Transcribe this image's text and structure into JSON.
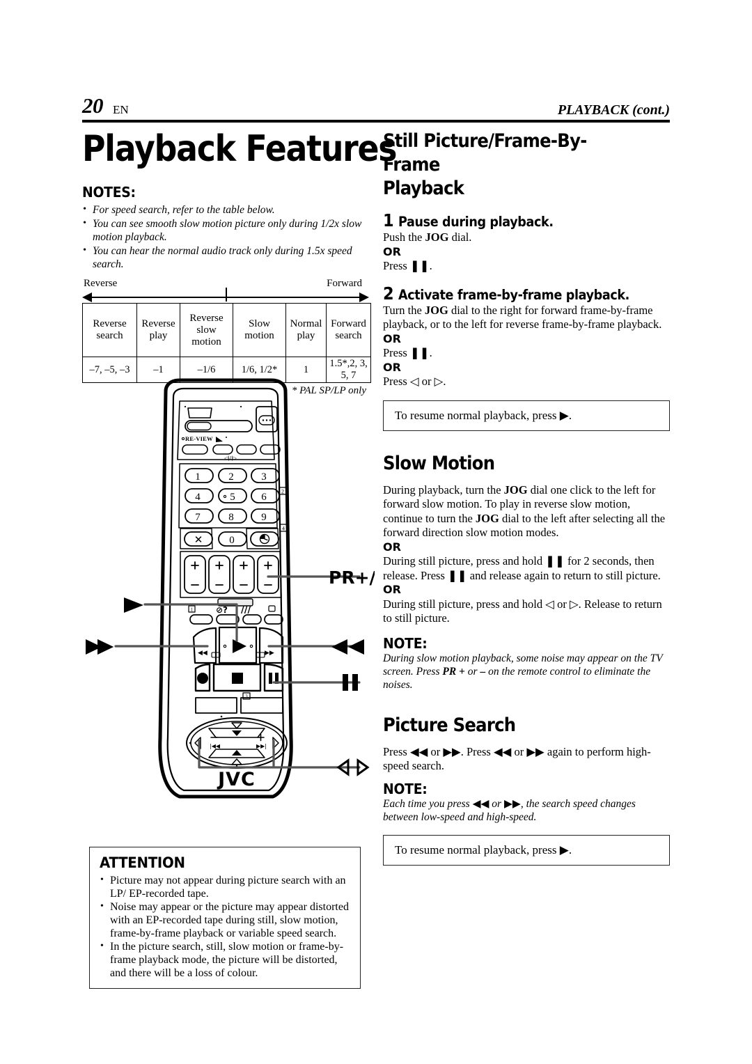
{
  "header": {
    "page_number": "20",
    "language": "EN",
    "running_head": "PLAYBACK (cont.)"
  },
  "left_column": {
    "title": "Playback Features",
    "notes_label": "NOTES:",
    "notes": [
      "For speed search, refer to the table below.",
      "You can see smooth slow motion picture only during 1/2x slow motion playback.",
      "You can hear the normal audio track only during 1.5x speed search."
    ],
    "table": {
      "direction_left": "Reverse",
      "direction_right": "Forward",
      "headers": [
        "Reverse search",
        "Reverse play",
        "Reverse slow motion",
        "Slow motion",
        "Normal play",
        "Forward search"
      ],
      "values": [
        "–7, –5, –3",
        "–1",
        "–1/6",
        "1/6, 1/2*",
        "1",
        "1.5*,2, 3, 5, 7"
      ],
      "footnote": "* PAL SP/LP only"
    }
  },
  "remote": {
    "brand": "JVC",
    "keypad": [
      "1",
      "2",
      "3",
      "4",
      "5",
      "6",
      "7",
      "8",
      "9",
      "X",
      "0",
      "⌚"
    ],
    "review_label": "RE-VIEW",
    "index_markers": [
      "1",
      "2",
      "3",
      "4"
    ],
    "callouts": {
      "pr": "PR+/−",
      "play": "play-arrow",
      "rew": "rewind-double-arrow",
      "ff": "fast-forward-double-arrow",
      "pause": "pause-bars",
      "lr": "left-right-triangles"
    }
  },
  "attention": {
    "label": "ATTENTION",
    "items": [
      "Picture may not appear during picture search with an LP/ EP-recorded tape.",
      "Noise may appear or the picture may appear distorted with an EP-recorded tape during still, slow motion, frame-by-frame playback or variable speed search.",
      "In the picture search, still, slow motion or frame-by-frame playback mode, the picture will be distorted, and there will be a loss of colour."
    ]
  },
  "right_column": {
    "section1": {
      "title_line1": "Still Picture/Frame-By-Frame",
      "title_line2": "Playback",
      "step1_num": "1",
      "step1_label": "Pause during playback.",
      "step1_line1_pre": "Push the ",
      "step1_line1_bold": "JOG",
      "step1_line1_post": " dial.",
      "or": "OR",
      "step1_line2_pre": "Press ",
      "step1_line2_post": ".",
      "step2_num": "2",
      "step2_label": "Activate frame-by-frame playback.",
      "step2_line1_pre": "Turn the ",
      "step2_line1_bold": "JOG",
      "step2_line1_post": " dial to the right for forward frame-by-frame playback, or to the left for reverse frame-by-frame playback.",
      "step2_or1": "OR",
      "step2_press_pause_pre": "Press ",
      "step2_press_pause_post": ".",
      "step2_or2": "OR",
      "step2_press_lr_pre": "Press ",
      "step2_press_lr_mid": " or ",
      "step2_press_lr_post": ".",
      "resume": "To resume normal playback, press"
    },
    "section2": {
      "title": "Slow Motion",
      "p1_a": "During playback, turn the ",
      "p1_bold1": "JOG",
      "p1_b": " dial one click to the left for forward slow motion. To play in reverse slow motion, continue to turn the ",
      "p1_bold2": "JOG",
      "p1_c": " dial to the left after selecting all the forward direction slow motion modes.",
      "or1": "OR",
      "p2_a": "During still picture, press and hold ",
      "p2_b": " for 2 seconds, then release. Press ",
      "p2_c": " and release again to return to still picture.",
      "or2": "OR",
      "p3_a": "During still picture, press and hold ",
      "p3_b": " or ",
      "p3_c": ". Release to return to still picture.",
      "note_label": "NOTE:",
      "note_a": "During slow motion playback, some noise may appear on the TV screen. Press ",
      "note_bold": "PR +",
      "note_b": " or ",
      "note_bold2": "–",
      "note_c": " on the remote control to eliminate the noises."
    },
    "section3": {
      "title": "Picture Search",
      "p1_a": "Press ",
      "p1_b": " or ",
      "p1_c": ". Press ",
      "p1_d": " or ",
      "p1_e": " again to perform high-speed search.",
      "note_label": "NOTE:",
      "note_a": "Each time you press ",
      "note_b": " or ",
      "note_c": ", the search speed changes between low-speed and high-speed.",
      "resume": "To resume normal playback, press"
    }
  }
}
